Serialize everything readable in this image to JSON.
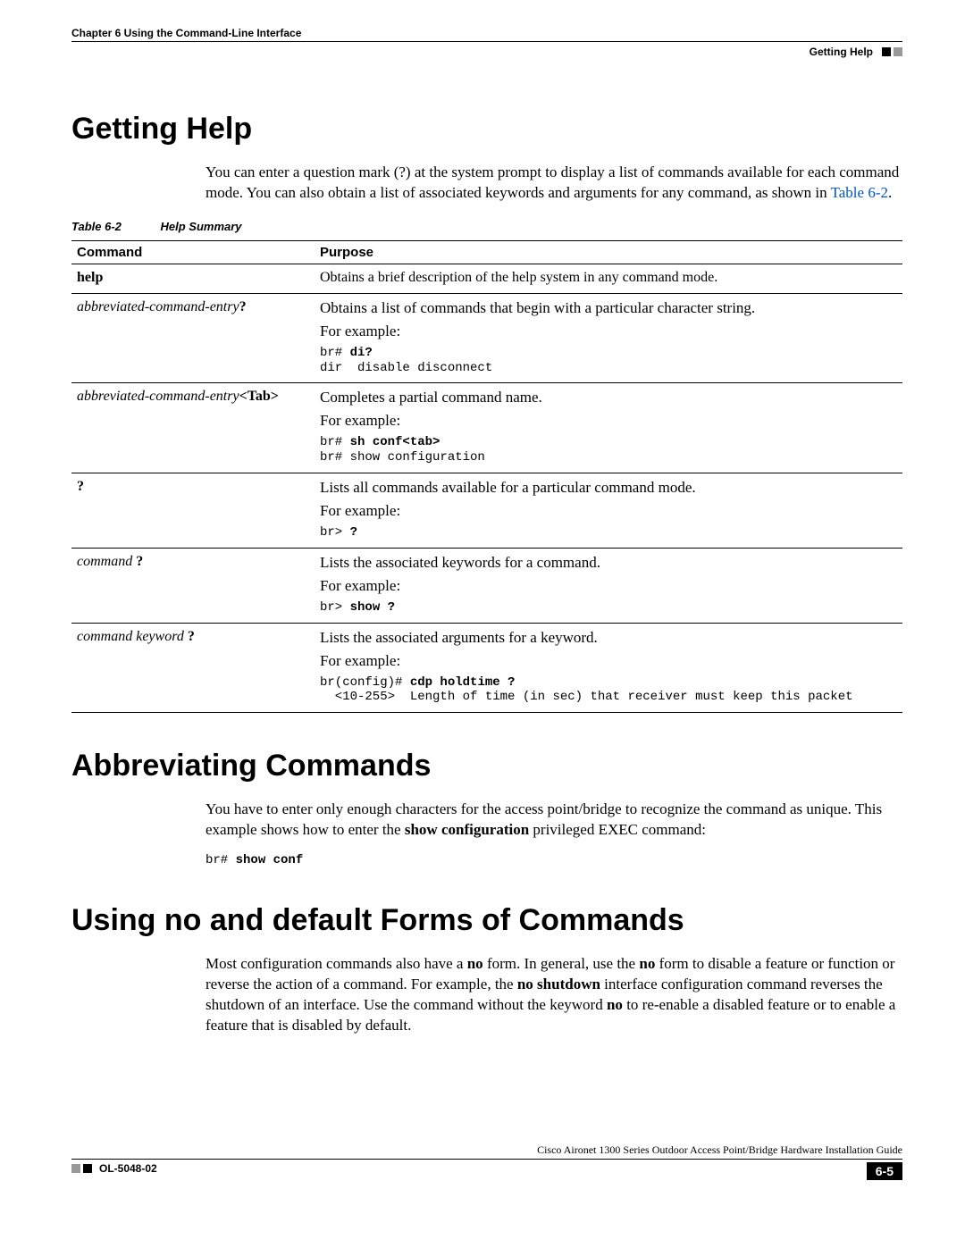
{
  "header": {
    "chapter_line": "Chapter 6    Using the Command-Line Interface",
    "section_right": "Getting Help"
  },
  "sections": {
    "getting_help": {
      "title": "Getting Help",
      "para_pre": "You can enter a question mark (?) at the system prompt to display a list of commands available for each command mode. You can also obtain a list of associated keywords and arguments for any command, as shown in ",
      "table_ref": "Table 6-2",
      "para_post": "."
    },
    "table": {
      "caption_num": "Table 6-2",
      "caption_text": "Help Summary",
      "head_command": "Command",
      "head_purpose": "Purpose",
      "rows": {
        "r1": {
          "cmd": "help",
          "purpose": "Obtains a brief description of the help system in any command mode."
        },
        "r2": {
          "cmd_italic": "abbreviated-command-entry",
          "cmd_suffix": "?",
          "purpose": "Obtains a list of commands that begin with a particular character string.",
          "example_label": "For example:",
          "mono_prefix": "br# ",
          "mono_bold": "di?",
          "mono_line2": "dir  disable disconnect"
        },
        "r3": {
          "cmd_italic": "abbreviated-command-entry",
          "cmd_suffix": "<Tab>",
          "purpose": "Completes a partial command name.",
          "example_label": "For example:",
          "mono_prefix": "br# ",
          "mono_bold": "sh conf<tab>",
          "mono_line2": "br# show configuration"
        },
        "r4": {
          "cmd": "?",
          "purpose": "Lists all commands available for a particular command mode.",
          "example_label": "For example:",
          "mono_prefix": "br> ",
          "mono_bold": "?"
        },
        "r5": {
          "cmd_italic": "command ",
          "cmd_suffix": "?",
          "purpose": "Lists the associated keywords for a command.",
          "example_label": "For example:",
          "mono_prefix": "br> ",
          "mono_bold": "show ?"
        },
        "r6": {
          "cmd_italic": "command keyword ",
          "cmd_suffix": "?",
          "purpose": "Lists the associated arguments for a keyword.",
          "example_label": "For example:",
          "mono_prefix": "br(config)# ",
          "mono_bold": "cdp holdtime ?",
          "mono_line2": "  <10-255>  Length of time (in sec) that receiver must keep this packet"
        }
      }
    },
    "abbrev": {
      "title": "Abbreviating Commands",
      "para_pre": "You have to enter only enough characters for the access point/bridge to recognize the command as unique. This example shows how to enter the ",
      "para_bold": "show configuration",
      "para_post": " privileged EXEC command:",
      "mono_prefix": "br# ",
      "mono_bold": "show conf"
    },
    "nodefault": {
      "title": "Using no and default Forms of Commands",
      "p1": "Most configuration commands also have a ",
      "b1": "no",
      "p2": " form. In general, use the ",
      "b2": "no",
      "p3": " form to disable a feature or function or reverse the action of a command. For example, the ",
      "b3": "no shutdown",
      "p4": " interface configuration command reverses the shutdown of an interface. Use the command without the keyword ",
      "b4": "no",
      "p5": " to re-enable a disabled feature or to enable a feature that is disabled by default."
    }
  },
  "footer": {
    "guide_title": "Cisco Aironet 1300 Series Outdoor Access Point/Bridge Hardware Installation Guide",
    "doc_id": "OL-5048-02",
    "page_num": "6-5"
  }
}
